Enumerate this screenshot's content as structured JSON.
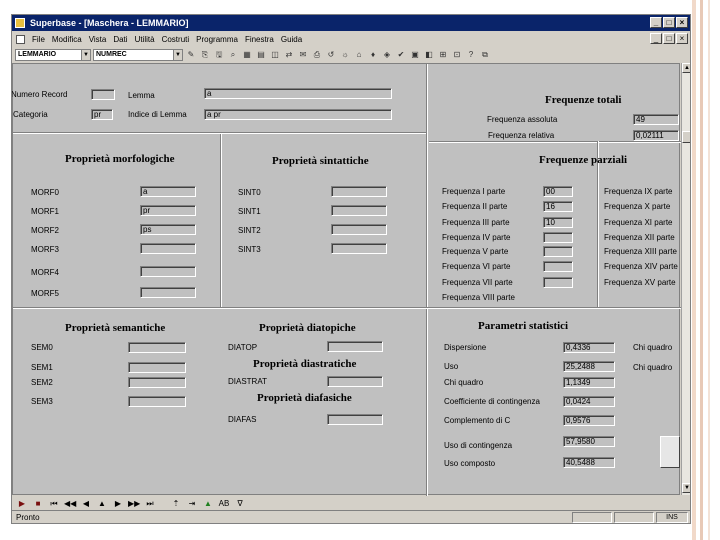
{
  "window": {
    "title": "Superbase - [Maschera - LEMMARIO]",
    "minimize": "_",
    "maximize": "□",
    "close": "×"
  },
  "menu": {
    "items": [
      "File",
      "Modifica",
      "Vista",
      "Dati",
      "Utilità",
      "Costruti",
      "Programma",
      "Finestra",
      "Guida"
    ]
  },
  "toolbar": {
    "file_combo": "LEMMARIO",
    "field_combo": "NUMREC",
    "icons": [
      "✎",
      "⎘",
      "🖫",
      "⌕",
      "▦",
      "▤",
      "◫",
      "⇄",
      "✉",
      "⎙",
      "↺",
      "☼",
      "⌂",
      "♦",
      "◈",
      "✔",
      "▣",
      "◧",
      "⊞",
      "⊡",
      "?",
      "⧉"
    ]
  },
  "header_fields": {
    "numero_record_label": "Numero Record",
    "numero_record_value": "",
    "lemma_label": "Lemma",
    "lemma_value": "a",
    "categoria_label": "Categoria",
    "categoria_value": "pr",
    "indice_label": "Indice di Lemma",
    "indice_value": "a pr"
  },
  "frequenze_totali": {
    "title": "Frequenze totali",
    "assoluta_label": "Frequenza assoluta",
    "assoluta_value": "49",
    "relativa_label": "Frequenza relativa",
    "relativa_value": "0,02111"
  },
  "frequenze_parziali": {
    "title": "Frequenze parziali",
    "left": [
      {
        "label": "Frequenza I parte",
        "value": "00"
      },
      {
        "label": "Frequenza II parte",
        "value": "16"
      },
      {
        "label": "Frequenza III parte",
        "value": "10"
      },
      {
        "label": "Frequenza IV parte",
        "value": ""
      },
      {
        "label": "Frequenza V parte",
        "value": ""
      },
      {
        "label": "Frequenza VI parte",
        "value": ""
      },
      {
        "label": "Frequenza VII parte",
        "value": ""
      },
      {
        "label": "Frequenza VIII parte",
        "value": ""
      }
    ],
    "right": [
      "Frequenza IX parte",
      "Frequenza X parte",
      "Frequenza XI parte",
      "Frequenza XII parte",
      "Frequenza XIII parte",
      "Frequenza XIV parte",
      "Frequenza XV parte"
    ]
  },
  "morfologiche": {
    "title": "Proprietà morfologiche",
    "rows": [
      {
        "label": "MORF0",
        "value": "a"
      },
      {
        "label": "MORF1",
        "value": "pr"
      },
      {
        "label": "MORF2",
        "value": "ps"
      },
      {
        "label": "MORF3",
        "value": ""
      },
      {
        "label": "MORF4",
        "value": ""
      },
      {
        "label": "MORF5",
        "value": ""
      }
    ]
  },
  "sintattiche": {
    "title": "Proprietà sintattiche",
    "rows": [
      {
        "label": "SINT0",
        "value": ""
      },
      {
        "label": "SINT1",
        "value": ""
      },
      {
        "label": "SINT2",
        "value": ""
      },
      {
        "label": "SINT3",
        "value": ""
      }
    ]
  },
  "semantiche": {
    "title": "Proprietà semantiche",
    "rows": [
      {
        "label": "SEM0",
        "value": ""
      },
      {
        "label": "SEM1",
        "value": ""
      },
      {
        "label": "SEM2",
        "value": ""
      },
      {
        "label": "SEM3",
        "value": ""
      }
    ]
  },
  "diatopiche": {
    "title": "Proprietà diatopiche",
    "label": "DIATOP",
    "value": ""
  },
  "diastratiche": {
    "title": "Proprietà diastratiche",
    "label": "DIASTRAT",
    "value": ""
  },
  "diafasiche": {
    "title": "Proprietà diafasiche",
    "label": "DIAFAS",
    "value": ""
  },
  "parametri": {
    "title": "Parametri statistici",
    "rows": [
      {
        "label": "Dispersione",
        "value": "0,4336"
      },
      {
        "label": "Uso",
        "value": "25,2488"
      },
      {
        "label": "Chi quadro",
        "value": "1,1349"
      },
      {
        "label": "Coefficiente di contingenza",
        "value": "0,0424"
      },
      {
        "label": "Complemento di C",
        "value": "0,9576"
      },
      {
        "label": "Uso di contingenza",
        "value": "57,9580"
      },
      {
        "label": "Uso composto",
        "value": "40,5488"
      }
    ],
    "chi_quadro_label_1": "Chi quadro",
    "chi_quadro_label_2": "Chi quadro"
  },
  "navigation": {
    "buttons": [
      "▶",
      "■",
      "⏮",
      "◀◀",
      "◀",
      "▲",
      "▶",
      "▶▶",
      "⏭",
      "⇡",
      "⇥",
      "▲",
      "AB",
      "∇"
    ]
  },
  "status": {
    "text": "Pronto",
    "ins": "INS"
  }
}
